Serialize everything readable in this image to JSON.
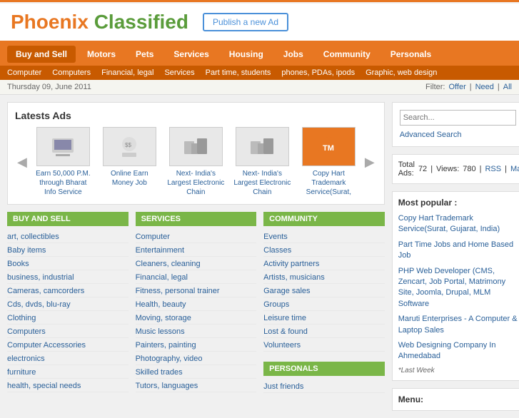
{
  "site": {
    "title_part1": "Phoenix",
    "title_part2": " Classified",
    "publish_btn": "Publish a new Ad"
  },
  "main_nav": {
    "items": [
      {
        "label": "Buy and Sell",
        "active": true
      },
      {
        "label": "Motors",
        "active": false
      },
      {
        "label": "Pets",
        "active": false
      },
      {
        "label": "Services",
        "active": false
      },
      {
        "label": "Housing",
        "active": false
      },
      {
        "label": "Jobs",
        "active": false
      },
      {
        "label": "Community",
        "active": false
      },
      {
        "label": "Personals",
        "active": false
      }
    ]
  },
  "sub_nav": {
    "items": [
      {
        "label": "Computer"
      },
      {
        "label": "Computers"
      },
      {
        "label": "Financial, legal"
      },
      {
        "label": "Services"
      },
      {
        "label": "Part time, students"
      },
      {
        "label": "phones, PDAs, ipods"
      },
      {
        "label": "Graphic, web design"
      }
    ]
  },
  "date_bar": {
    "date": "Thursday 09, June 2011",
    "filter_label": "Filter:",
    "filter_offer": "Offer",
    "filter_need": "Need",
    "filter_all": "All"
  },
  "latest_ads": {
    "title": "Latests Ads",
    "items": [
      {
        "title": "Earn 50,000 P.M. through Bharat Info Service"
      },
      {
        "title": "Online Earn Money Job"
      },
      {
        "title": "Next- India's Largest Electronic Chain"
      },
      {
        "title": "Next- India's Largest Electronic Chain"
      },
      {
        "title": "Copy Hart Trademark Service(Surat,"
      }
    ]
  },
  "categories": {
    "buy_and_sell": {
      "header": "BUY AND SELL",
      "items": [
        "art, collectibles",
        "Baby items",
        "Books",
        "business, industrial",
        "Cameras, camcorders",
        "Cds, dvds, blu-ray",
        "Clothing",
        "Computers",
        "Computer Accessories",
        "electronics",
        "furniture",
        "health, special needs"
      ]
    },
    "services": {
      "header": "SERVICES",
      "items": [
        "Computer",
        "Entertainment",
        "Cleaners, cleaning",
        "Financial, legal",
        "Fitness, personal trainer",
        "Health, beauty",
        "Moving, storage",
        "Music lessons",
        "Painters, painting",
        "Photography, video",
        "Skilled trades",
        "Tutors, languages"
      ]
    },
    "community": {
      "header": "COMMUNITY",
      "items": [
        "Events",
        "Classes",
        "Activity partners",
        "Artists, musicians",
        "Garage sales",
        "Groups",
        "Leisure time",
        "Lost & found",
        "Volunteers"
      ]
    },
    "personals": {
      "header": "PERSONALS",
      "items": [
        "Just friends"
      ]
    }
  },
  "sidebar": {
    "search": {
      "placeholder": "Search...",
      "advanced_label": "Advanced Search"
    },
    "stats": {
      "total_label": "Total Ads:",
      "total_value": "72",
      "views_label": "Views:",
      "views_value": "780",
      "rss_label": "RSS",
      "map_label": "Map"
    },
    "popular": {
      "title": "Most popular :",
      "items": [
        "Copy Hart Trademark Service(Surat, Gujarat, India)",
        "Part Time Jobs and Home Based Job",
        "PHP Web Developer (CMS, Zencart, Job Portal, Matrimony Site, Joomla, Drupal, MLM Software",
        "Maruti Enterprises - A Computer & Laptop Sales",
        "Web Designing Company In Ahmedabad"
      ],
      "last_week": "*Last Week"
    },
    "menu": {
      "title": "Menu:"
    }
  }
}
